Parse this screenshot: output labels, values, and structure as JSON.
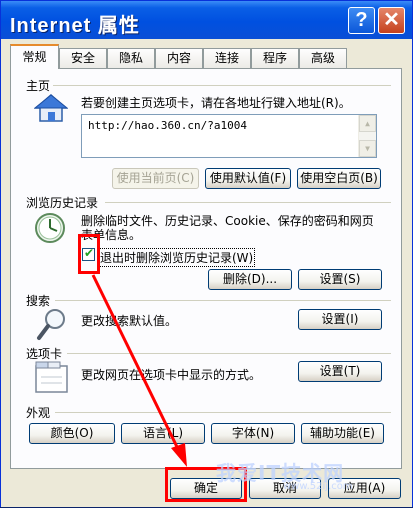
{
  "window": {
    "title": "Internet 属性",
    "help_glyph": "?",
    "close_glyph": "✕"
  },
  "tabs": [
    {
      "label": "常规",
      "active": true
    },
    {
      "label": "安全",
      "active": false
    },
    {
      "label": "隐私",
      "active": false
    },
    {
      "label": "内容",
      "active": false
    },
    {
      "label": "连接",
      "active": false
    },
    {
      "label": "程序",
      "active": false
    },
    {
      "label": "高级",
      "active": false
    }
  ],
  "homepage": {
    "group_label": "主页",
    "description": "若要创建主页选项卡，请在各地址行键入地址(R)。",
    "url_value": "http://hao.360.cn/?a1004",
    "btn_use_current": "使用当前页(C)",
    "btn_use_default": "使用默认值(F)",
    "btn_use_blank": "使用空白页(B)"
  },
  "history": {
    "group_label": "浏览历史记录",
    "description_line1": "删除临时文件、历史记录、Cookie、保存的密码和网页",
    "description_line2": "表单信息。",
    "checkbox_label": "退出时删除浏览历史记录(W)",
    "checkbox_checked": true,
    "btn_delete": "删除(D)...",
    "btn_settings": "设置(S)"
  },
  "search": {
    "group_label": "搜索",
    "description": "更改搜索默认值。",
    "btn_settings": "设置(I)"
  },
  "tabs_section": {
    "group_label": "选项卡",
    "description": "更改网页在选项卡中显示的方式。",
    "btn_settings": "设置(T)"
  },
  "appearance": {
    "group_label": "外观",
    "btn_colors": "颜色(O)",
    "btn_languages": "语言(L)",
    "btn_fonts": "字体(N)",
    "btn_accessibility": "辅助功能(E)"
  },
  "footer": {
    "btn_ok": "确定",
    "btn_cancel": "取消",
    "btn_apply": "应用(A)"
  },
  "watermark": {
    "text": "我爱IT技术网",
    "url": "www.52ij.com"
  },
  "colors": {
    "title_bar": "#0054e3",
    "annotation_red": "#ff0000",
    "active_tab_accent": "#e68b2c"
  }
}
